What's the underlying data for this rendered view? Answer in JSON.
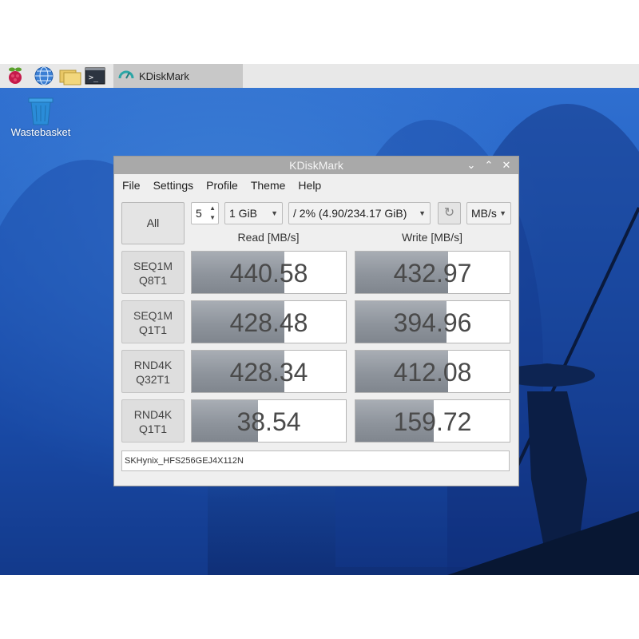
{
  "taskbar": {
    "icons": [
      "raspberry-icon",
      "globe-icon",
      "folder-icon",
      "terminal-icon"
    ],
    "task_label": "KDiskMark",
    "task_icon": "gauge-icon"
  },
  "desktop": {
    "wastebasket_label": "Wastebasket"
  },
  "window": {
    "title": "KDiskMark",
    "controls": [
      "chevron-down-icon",
      "chevron-up-icon",
      "close-icon"
    ],
    "menu": [
      "File",
      "Settings",
      "Profile",
      "Theme",
      "Help"
    ],
    "toolbar": {
      "all_label": "All",
      "runs_value": "5",
      "size_value": "1 GiB",
      "target_value": "/ 2% (4.90/234.17 GiB)",
      "unit_value": "MB/s"
    },
    "headers": {
      "read": "Read [MB/s]",
      "write": "Write [MB/s]"
    },
    "rows": [
      {
        "line1": "SEQ1M",
        "line2": "Q8T1",
        "read": "440.58",
        "write": "432.97",
        "read_fill": 0.6,
        "write_fill": 0.6
      },
      {
        "line1": "SEQ1M",
        "line2": "Q1T1",
        "read": "428.48",
        "write": "394.96",
        "read_fill": 0.6,
        "write_fill": 0.59
      },
      {
        "line1": "RND4K",
        "line2": "Q32T1",
        "read": "428.34",
        "write": "412.08",
        "read_fill": 0.6,
        "write_fill": 0.6
      },
      {
        "line1": "RND4K",
        "line2": "Q1T1",
        "read": "38.54",
        "write": "159.72",
        "read_fill": 0.43,
        "write_fill": 0.51
      }
    ],
    "device": "SKHynix_HFS256GEJ4X112N"
  }
}
